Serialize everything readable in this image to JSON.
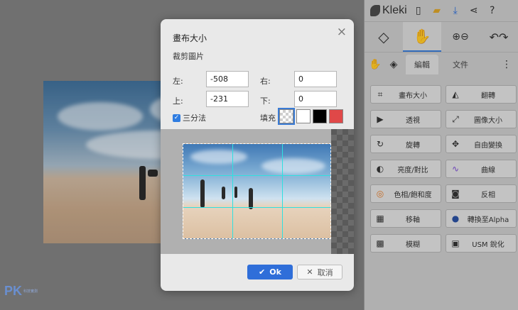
{
  "app": {
    "name": "Kleki"
  },
  "topbar": {
    "icons": [
      "new-file-icon",
      "open-folder-icon",
      "download-icon",
      "share-icon",
      "help-icon"
    ]
  },
  "tools": {
    "items": [
      "shape-tool-icon",
      "hand-tool-icon",
      "zoom-icon",
      "undo-redo-icon"
    ]
  },
  "panel_tabs": [
    {
      "label": "編輯",
      "active": true
    },
    {
      "label": "文件",
      "active": false
    }
  ],
  "edit_tools": [
    {
      "icon": "crop-icon",
      "label": "畫布大小"
    },
    {
      "icon": "flip-icon",
      "label": "翻轉"
    },
    {
      "icon": "play-icon",
      "label": "透視"
    },
    {
      "icon": "resize-icon",
      "label": "圖像大小"
    },
    {
      "icon": "rotate-icon",
      "label": "旋轉"
    },
    {
      "icon": "transform-icon",
      "label": "自由變換"
    },
    {
      "icon": "brightness-icon",
      "label": "亮度/對比"
    },
    {
      "icon": "curves-icon",
      "label": "曲線"
    },
    {
      "icon": "hue-icon",
      "label": "色相/飽和度"
    },
    {
      "icon": "invert-icon",
      "label": "反相"
    },
    {
      "icon": "tilt-icon",
      "label": "移軸"
    },
    {
      "icon": "alpha-icon",
      "label": "轉換至Alpha"
    },
    {
      "icon": "blur-icon",
      "label": "模糊"
    },
    {
      "icon": "sharpen-icon",
      "label": "USM 銳化"
    }
  ],
  "dialog": {
    "title": "畫布大小",
    "subtitle": "裁剪圖片",
    "close": "×",
    "fields": {
      "left_label": "左:",
      "left_value": "-508",
      "right_label": "右:",
      "right_value": "0",
      "top_label": "上:",
      "top_value": "-231",
      "bottom_label": "下:",
      "bottom_value": "0"
    },
    "thirds_label": "三分法",
    "thirds_checked": true,
    "fill_label": "填充",
    "fill_swatches": [
      "#ffffff00",
      "#ffffff",
      "#000000",
      "#e04848"
    ],
    "ok_label": "Ok",
    "cancel_label": "取消"
  },
  "watermark": {
    "text": "PK",
    "sub": "科技實測"
  }
}
